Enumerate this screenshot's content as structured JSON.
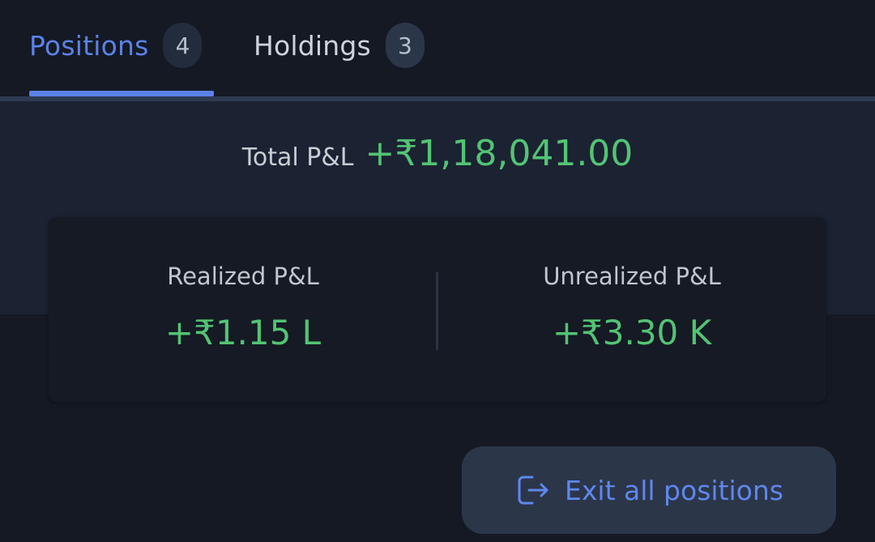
{
  "tabs": [
    {
      "label": "Positions",
      "count": "4",
      "active": true
    },
    {
      "label": "Holdings",
      "count": "3",
      "active": false
    }
  ],
  "summary": {
    "total_label": "Total P&L",
    "total_value": "+₹1,18,041.00",
    "realized_label": "Realized P&L",
    "realized_value": "+₹1.15 L",
    "unrealized_label": "Unrealized P&L",
    "unrealized_value": "+₹3.30 K"
  },
  "exit_button": {
    "label": "Exit all positions",
    "icon": "exit-icon"
  },
  "colors": {
    "accent": "#5b82e8",
    "profit": "#53c374",
    "background": "#141923"
  }
}
